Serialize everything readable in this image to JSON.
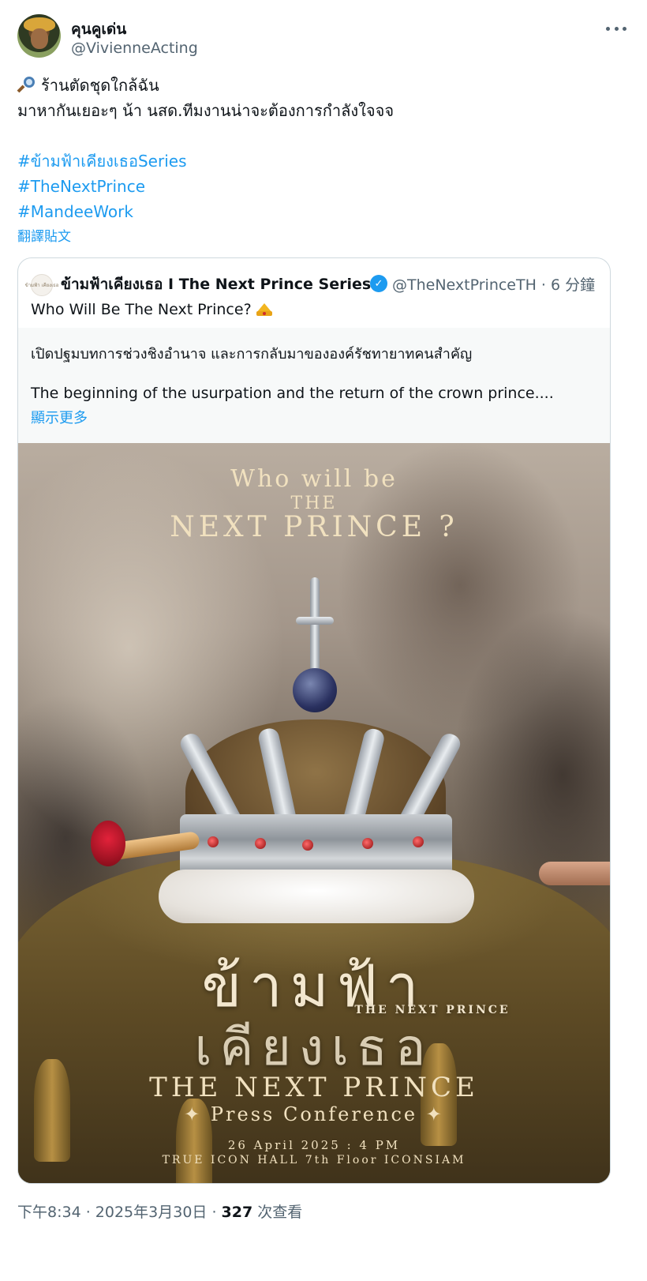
{
  "author": {
    "display_name": "คุนคูเด่น",
    "handle": "@VivienneActing"
  },
  "tweet": {
    "lines": [
      "ร้านตัดชุดใกล้ฉัน",
      "มาหากันเยอะๆ น้า นสด.ทีมงานน่าจะต้องการกำลังใจจจ"
    ],
    "hashtags": [
      "#ข้ามฟ้าเคียงเธอSeries",
      "#TheNextPrince",
      "#MandeeWork"
    ],
    "translate_label": "翻譯貼文"
  },
  "quote": {
    "display_name": "ข้ามฟ้าเคียงเธอ I The Next Prince Series",
    "handle_time": "@TheNextPrinceTH · 6 分鐘",
    "text": "Who Will Be The Next Prince?",
    "detail_thai": "เปิดปฐมบทการช่วงชิงอำนาจ และการกลับมาขององค์รัชทายาทคนสำคัญ",
    "detail_en": "The beginning of the usurpation and the return of the crown prince....",
    "show_more": "顯示更多",
    "avatar_text": "ข้ามฟ้า เคียงเธอ"
  },
  "poster": {
    "title_line1": "Who will be",
    "title_line2": "THE",
    "title_line3": "NEXT PRINCE ?",
    "logo_thai_line1": "ข้ามฟ้า",
    "logo_small": "THE NEXT PRINCE",
    "logo_thai_line2": "เคียงเธอ",
    "event_title": "THE NEXT PRINCE",
    "event_subtitle": "✦ Press Conference ✦",
    "event_date": "26 April 2025 : 4 PM",
    "event_venue": "TRUE ICON HALL 7th Floor ICONSIAM"
  },
  "footer": {
    "time_date": "下午8:34 · 2025年3月30日 · ",
    "views_count": "327",
    "views_label": " 次查看"
  },
  "colors": {
    "link": "#1d9bf0",
    "secondary_text": "#536471",
    "primary_text": "#0f1419",
    "verified": "#1d9bf0"
  }
}
